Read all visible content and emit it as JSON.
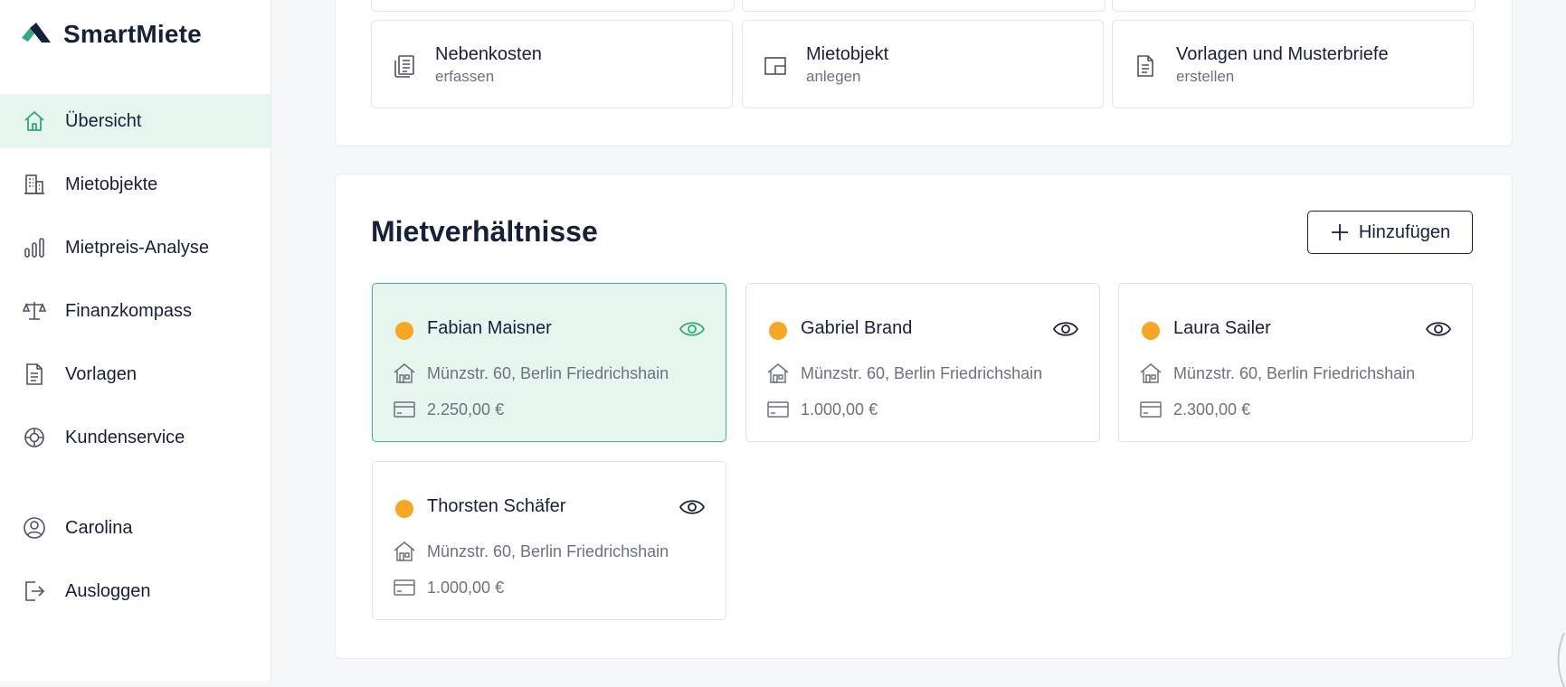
{
  "app": {
    "name": "SmartMiete"
  },
  "sidebar": {
    "items": [
      {
        "label": "Übersicht"
      },
      {
        "label": "Mietobjekte"
      },
      {
        "label": "Mietpreis-Analyse"
      },
      {
        "label": "Finanzkompass"
      },
      {
        "label": "Vorlagen"
      },
      {
        "label": "Kundenservice"
      },
      {
        "label": "Carolina"
      },
      {
        "label": "Ausloggen"
      }
    ]
  },
  "quick_actions": [
    {
      "title": "Nebenkosten",
      "subtitle": "erfassen",
      "icon": "receipt-icon"
    },
    {
      "title": "Mietobjekt",
      "subtitle": "anlegen",
      "icon": "floorplan-icon"
    },
    {
      "title": "Vorlagen und Musterbriefe",
      "subtitle": "erstellen",
      "icon": "document-icon"
    }
  ],
  "tenancies": {
    "title": "Mietverhältnisse",
    "add_label": "Hinzufügen",
    "items": [
      {
        "name": "Fabian Maisner",
        "address": "Münzstr. 60, Berlin Friedrichshain",
        "rent": "2.250,00 €",
        "status_color": "#f5a623",
        "selected": true
      },
      {
        "name": "Gabriel Brand",
        "address": "Münzstr. 60, Berlin Friedrichshain",
        "rent": "1.000,00 €",
        "status_color": "#f5a623",
        "selected": false
      },
      {
        "name": "Laura Sailer",
        "address": "Münzstr. 60, Berlin Friedrichshain",
        "rent": "2.300,00 €",
        "status_color": "#f5a623",
        "selected": false
      },
      {
        "name": "Thorsten Schäfer",
        "address": "Münzstr. 60, Berlin Friedrichshain",
        "rent": "1.000,00 €",
        "status_color": "#f5a623",
        "selected": false
      }
    ]
  },
  "colors": {
    "brand_green": "#2fa97d",
    "navy": "#17203a",
    "active_bg": "#e6f6ef",
    "status_orange": "#f5a623"
  }
}
